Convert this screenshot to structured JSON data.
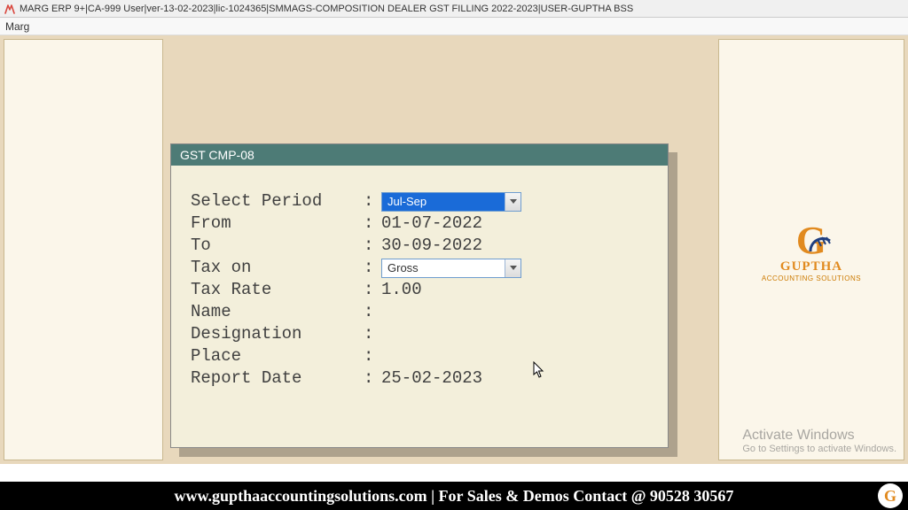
{
  "window": {
    "title": "MARG ERP 9+|CA-999 User|ver-13-02-2023|lic-1024365|SMMAGS-COMPOSITION DEALER GST FILLING 2022-2023|USER-GUPTHA BSS"
  },
  "menu": {
    "item1": "Marg"
  },
  "dialog": {
    "title": "GST CMP-08",
    "labels": {
      "select_period": "Select Period",
      "from": "From",
      "to": "To",
      "tax_on": "Tax on",
      "tax_rate": "Tax Rate",
      "name": "Name",
      "designation": "Designation",
      "place": "Place",
      "report_date": "Report Date"
    },
    "values": {
      "select_period": "Jul-Sep",
      "from": "01-07-2022",
      "to": "30-09-2022",
      "tax_on": "Gross",
      "tax_rate": " 1.00",
      "name": "",
      "designation": "",
      "place": "",
      "report_date": "25-02-2023"
    }
  },
  "logo": {
    "letter": "G",
    "line1": "GUPTHA",
    "line2": "ACCOUNTING SOLUTIONS"
  },
  "watermark": {
    "line1": "Activate Windows",
    "line2": "Go to Settings to activate Windows."
  },
  "footer": {
    "text": "www.gupthaaccountingsolutions.com | For Sales & Demos Contact @ 90528 30567"
  }
}
